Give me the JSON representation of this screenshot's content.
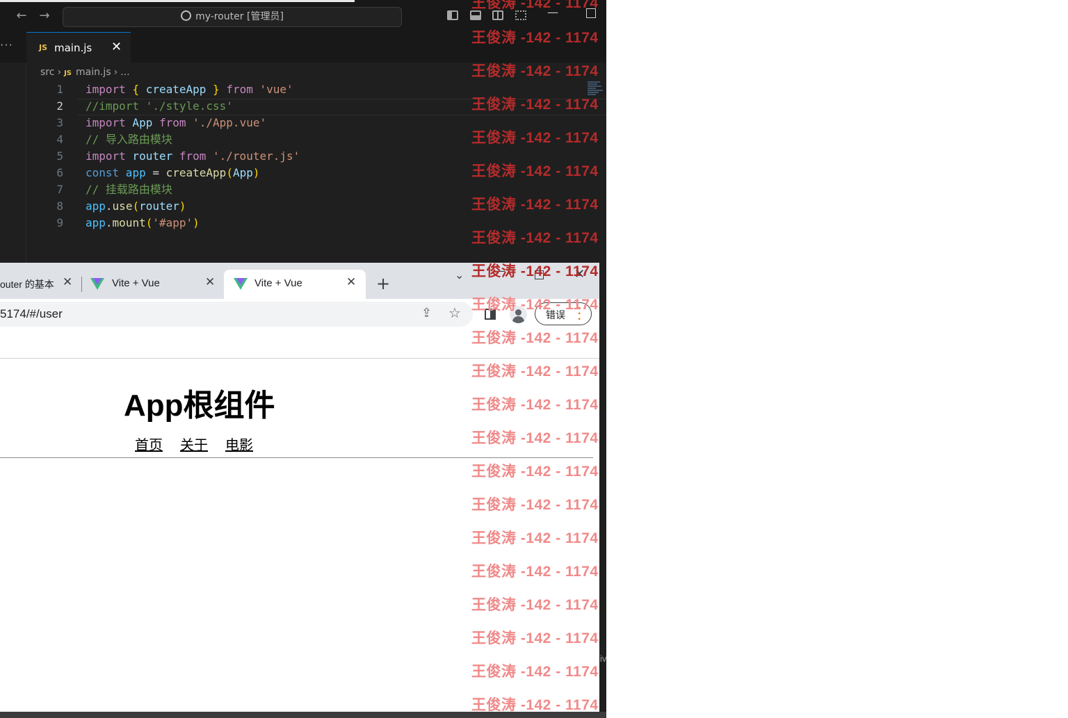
{
  "vscode": {
    "command_center": "my-router [管理员]",
    "more_label": "···",
    "tab": {
      "badge": "JS",
      "name": "main.js",
      "close": "✕"
    },
    "breadcrumb": {
      "folder": "src",
      "badge": "JS",
      "file": "main.js",
      "more": "..."
    },
    "code_lines": [
      {
        "num": "1",
        "tokens": [
          {
            "t": "import",
            "c": "#c586c0"
          },
          {
            "t": " ",
            "c": "#d4d4d4"
          },
          {
            "t": "{",
            "c": "#ffd700"
          },
          {
            "t": " createApp ",
            "c": "#9cdcfe"
          },
          {
            "t": "}",
            "c": "#ffd700"
          },
          {
            "t": " from ",
            "c": "#c586c0"
          },
          {
            "t": "'vue'",
            "c": "#ce9178"
          }
        ]
      },
      {
        "num": "2",
        "tokens": [
          {
            "t": "//import './style.css'",
            "c": "#6a9955"
          }
        ]
      },
      {
        "num": "3",
        "tokens": [
          {
            "t": "import",
            "c": "#c586c0"
          },
          {
            "t": " App ",
            "c": "#9cdcfe"
          },
          {
            "t": "from",
            "c": "#c586c0"
          },
          {
            "t": " './App.vue'",
            "c": "#ce9178"
          }
        ]
      },
      {
        "num": "4",
        "tokens": [
          {
            "t": "// 导入路由模块",
            "c": "#6a9955"
          }
        ]
      },
      {
        "num": "5",
        "tokens": [
          {
            "t": "import",
            "c": "#c586c0"
          },
          {
            "t": " router ",
            "c": "#9cdcfe"
          },
          {
            "t": "from",
            "c": "#c586c0"
          },
          {
            "t": " './router.js'",
            "c": "#ce9178"
          }
        ]
      },
      {
        "num": "6",
        "tokens": [
          {
            "t": "const",
            "c": "#569cd6"
          },
          {
            "t": " app ",
            "c": "#4fc1ff"
          },
          {
            "t": "= ",
            "c": "#d4d4d4"
          },
          {
            "t": "createApp",
            "c": "#dcdcaa"
          },
          {
            "t": "(",
            "c": "#ffd700"
          },
          {
            "t": "App",
            "c": "#9cdcfe"
          },
          {
            "t": ")",
            "c": "#ffd700"
          }
        ]
      },
      {
        "num": "7",
        "tokens": [
          {
            "t": "// 挂载路由模块",
            "c": "#6a9955"
          }
        ]
      },
      {
        "num": "8",
        "tokens": [
          {
            "t": "app",
            "c": "#4fc1ff"
          },
          {
            "t": ".",
            "c": "#d4d4d4"
          },
          {
            "t": "use",
            "c": "#dcdcaa"
          },
          {
            "t": "(",
            "c": "#ffd700"
          },
          {
            "t": "router",
            "c": "#9cdcfe"
          },
          {
            "t": ")",
            "c": "#ffd700"
          }
        ]
      },
      {
        "num": "9",
        "tokens": [
          {
            "t": "app",
            "c": "#4fc1ff"
          },
          {
            "t": ".",
            "c": "#d4d4d4"
          },
          {
            "t": "mount",
            "c": "#dcdcaa"
          },
          {
            "t": "(",
            "c": "#ffd700"
          },
          {
            "t": "'#app'",
            "c": "#ce9178"
          },
          {
            "t": ")",
            "c": "#ffd700"
          }
        ]
      }
    ],
    "active_line": "2"
  },
  "browser": {
    "tabs": [
      {
        "title": "outer 的基本",
        "close": "✕"
      },
      {
        "title": "Vite + Vue",
        "close": "✕"
      },
      {
        "title": "Vite + Vue",
        "close": "✕"
      }
    ],
    "new_tab": "+",
    "url": "5174/#/user",
    "error_button": "错误",
    "page": {
      "heading": "App根组件",
      "nav": [
        "首页",
        "关于",
        "电影"
      ]
    }
  },
  "watermark": {
    "text": "王俊涛 -142 - 1174",
    "colors": {
      "dark": "#b42b2b",
      "light": "#f08a8a"
    }
  },
  "edge_text": "iv"
}
